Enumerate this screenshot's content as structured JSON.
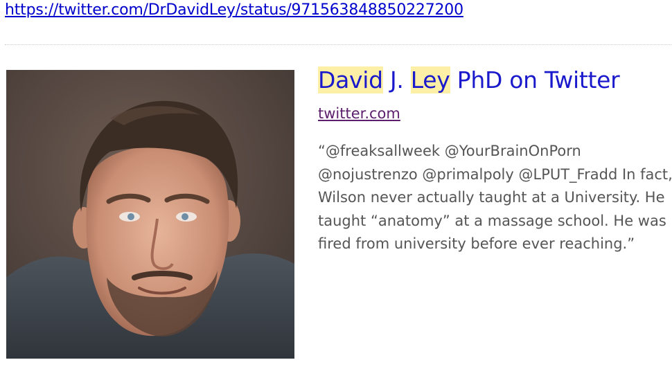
{
  "page": {
    "url": "https://twitter.com/DrDavidLey/status/971563848850227200"
  },
  "card": {
    "title_parts": {
      "hl1": "David",
      "sep1": " J. ",
      "hl2": "Ley",
      "rest": " PhD on Twitter"
    },
    "source": "twitter.com",
    "quote": "“@freaksallweek @YourBrainOnPorn @nojustrenzo @primalpoly @LPUT_Fradd In fact, Wilson never actually taught at a University. He taught “anatomy” at a massage school. He was fired from university before ever reaching.”"
  }
}
